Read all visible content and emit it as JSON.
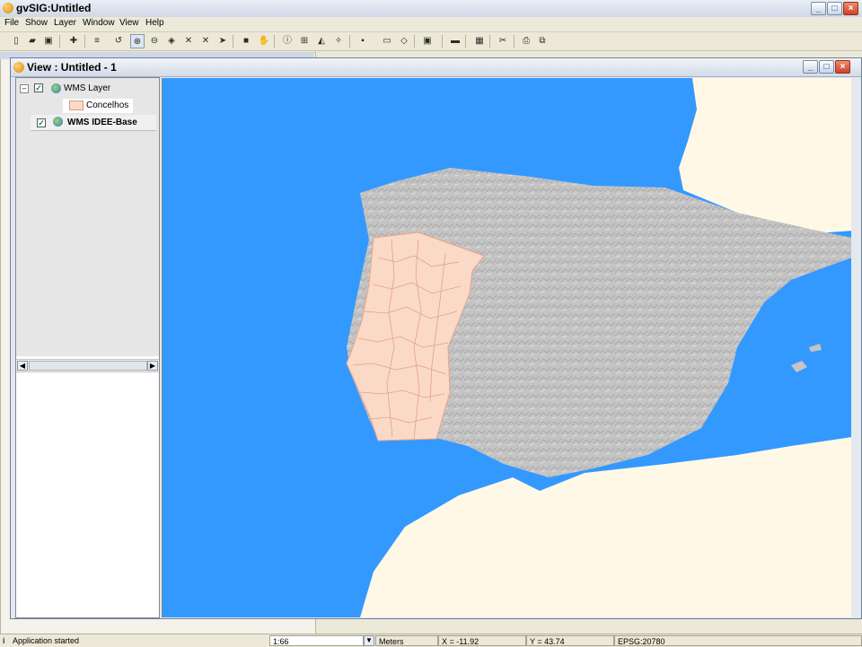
{
  "app": {
    "title": "gvSIG:Untitled",
    "menu": [
      "File",
      "Show",
      "Layer",
      "Window",
      "View",
      "Help"
    ]
  },
  "view_window": {
    "title": "View : Untitled - 1"
  },
  "toc": {
    "layers": [
      {
        "name": "WMS Layer",
        "checked": true,
        "expanded": true,
        "legend": [
          "Concelhos"
        ]
      },
      {
        "name": "WMS IDEE-Base",
        "checked": true,
        "expanded": false
      }
    ]
  },
  "status": {
    "message": "Application started",
    "scale": "1:66",
    "units": "Meters",
    "x": "X = -11.92",
    "y": "Y = 43.74",
    "crs": "EPSG:20780"
  },
  "colors": {
    "sea": "#3399ff",
    "land_neighbour": "#fff8e6",
    "relief": "#c4c4c4",
    "concelhos_fill": "#fbd9c7",
    "concelhos_line": "#e8a48a"
  }
}
